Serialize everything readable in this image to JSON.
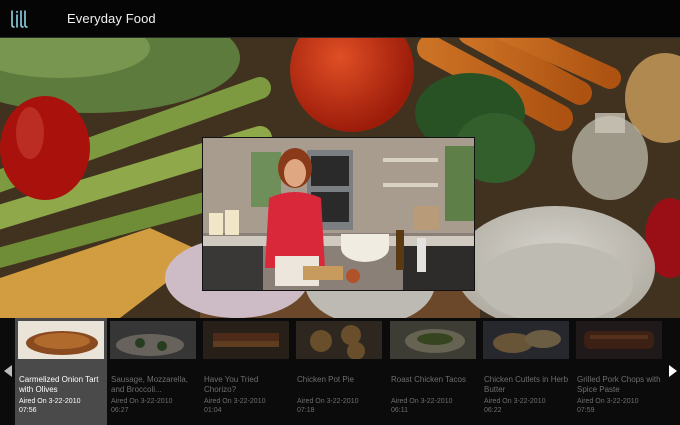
{
  "app": {
    "title": "Everyday Food",
    "logo_icon": "lill-logo-icon"
  },
  "carousel": {
    "prev_icon": "arrow-left-icon",
    "next_icon": "arrow-right-icon",
    "episodes": [
      {
        "title": "Carmelized Onion Tart with Olives",
        "aired": "Aired On 3-22-2010",
        "duration": "07:56",
        "selected": true
      },
      {
        "title": "Sausage, Mozzarella, and Broccoli...",
        "aired": "Aired On 3-22-2010",
        "duration": "06:27",
        "selected": false
      },
      {
        "title": "Have You Tried Chorizo?",
        "aired": "Aired On 3-22-2010",
        "duration": "01:04",
        "selected": false
      },
      {
        "title": "Chicken Pot Pie",
        "aired": "Aired On 3-22-2010",
        "duration": "07:18",
        "selected": false
      },
      {
        "title": "Roast Chicken Tacos",
        "aired": "Aired On 3-22-2010",
        "duration": "06:11",
        "selected": false
      },
      {
        "title": "Chicken Cutlets in Herb Butter",
        "aired": "Aired On 3-22-2010",
        "duration": "06:22",
        "selected": false
      },
      {
        "title": "Grilled Pork Chops with Spice Paste",
        "aired": "Aired On 3-22-2010",
        "duration": "07:59",
        "selected": false
      }
    ]
  }
}
